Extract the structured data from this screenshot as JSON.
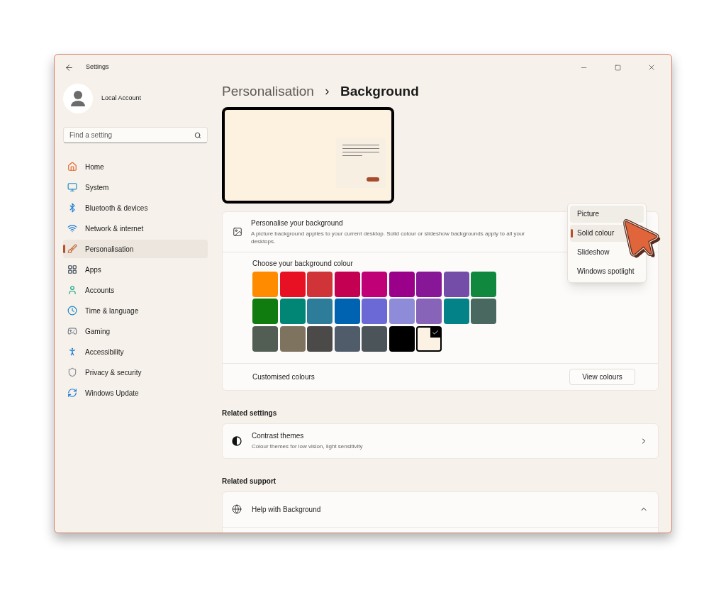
{
  "window": {
    "title": "Settings"
  },
  "account": {
    "name": "Local Account"
  },
  "search": {
    "placeholder": "Find a setting"
  },
  "nav": [
    {
      "label": "Home",
      "selected": false
    },
    {
      "label": "System",
      "selected": false
    },
    {
      "label": "Bluetooth & devices",
      "selected": false
    },
    {
      "label": "Network & internet",
      "selected": false
    },
    {
      "label": "Personalisation",
      "selected": true
    },
    {
      "label": "Apps",
      "selected": false
    },
    {
      "label": "Accounts",
      "selected": false
    },
    {
      "label": "Time & language",
      "selected": false
    },
    {
      "label": "Gaming",
      "selected": false
    },
    {
      "label": "Accessibility",
      "selected": false
    },
    {
      "label": "Privacy & security",
      "selected": false
    },
    {
      "label": "Windows Update",
      "selected": false
    }
  ],
  "breadcrumb": {
    "parent": "Personalisation",
    "current": "Background"
  },
  "background": {
    "title": "Personalise your background",
    "description": "A picture background applies to your current desktop. Solid colour or slideshow backgrounds apply to all your desktops.",
    "options": [
      {
        "label": "Picture",
        "selected": false
      },
      {
        "label": "Solid colour",
        "selected": true
      },
      {
        "label": "Slideshow",
        "selected": false
      },
      {
        "label": "Windows spotlight",
        "selected": false
      }
    ]
  },
  "colours": {
    "label": "Choose your background colour",
    "swatches": [
      {
        "color": "#ff8c00",
        "selected": false
      },
      {
        "color": "#e81123",
        "selected": false
      },
      {
        "color": "#d13438",
        "selected": false
      },
      {
        "color": "#c30052",
        "selected": false
      },
      {
        "color": "#bf0077",
        "selected": false
      },
      {
        "color": "#9a0089",
        "selected": false
      },
      {
        "color": "#881798",
        "selected": false
      },
      {
        "color": "#744da9",
        "selected": false
      },
      {
        "color": "#10893e",
        "selected": false
      },
      {
        "color": "#107c10",
        "selected": false
      },
      {
        "color": "#018574",
        "selected": false
      },
      {
        "color": "#2d7d9a",
        "selected": false
      },
      {
        "color": "#0063b1",
        "selected": false
      },
      {
        "color": "#6b69d6",
        "selected": false
      },
      {
        "color": "#8e8cd8",
        "selected": false
      },
      {
        "color": "#8764b8",
        "selected": false
      },
      {
        "color": "#038387",
        "selected": false
      },
      {
        "color": "#486860",
        "selected": false
      },
      {
        "color": "#525e54",
        "selected": false
      },
      {
        "color": "#7e735f",
        "selected": false
      },
      {
        "color": "#4c4a48",
        "selected": false
      },
      {
        "color": "#515c6b",
        "selected": false
      },
      {
        "color": "#4a5459",
        "selected": false
      },
      {
        "color": "#000000",
        "selected": false
      },
      {
        "color": "#fcf2e3",
        "selected": true
      }
    ]
  },
  "custom": {
    "label": "Customised colours",
    "button": "View colours"
  },
  "related_settings": {
    "heading": "Related settings",
    "items": [
      {
        "title": "Contrast themes",
        "subtitle": "Colour themes for low vision, light sensitivity"
      }
    ]
  },
  "related_support": {
    "heading": "Related support",
    "items": [
      {
        "title": "Help with Background",
        "expanded": true
      }
    ]
  }
}
